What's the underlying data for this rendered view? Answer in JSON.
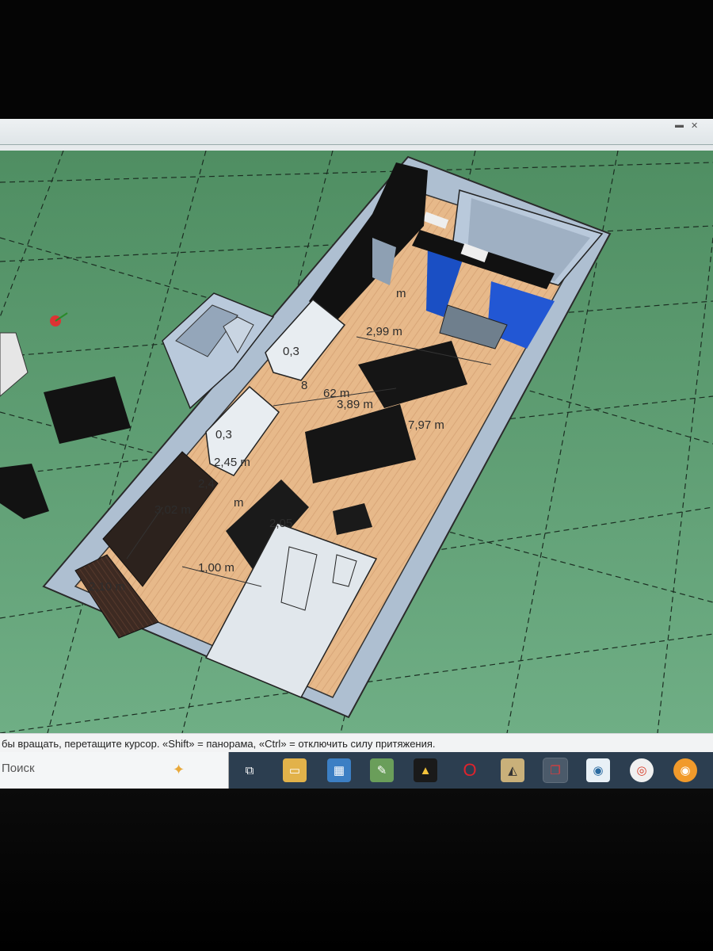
{
  "app": {
    "name": "SketchUp"
  },
  "dimensions": [
    "m",
    "2,99 m",
    "0,3",
    "8",
    "62 m",
    "3,89 m",
    "7,97 m",
    "0,3",
    "2,45 m",
    "2,4",
    "3,02 m",
    "m",
    "2,05",
    "1,00 m",
    "2,10 m"
  ],
  "status_bar": {
    "hint": "бы вращать, перетащите курсор. «Shift» = панорама, «Ctrl» = отключить силу притяжения."
  },
  "taskbar": {
    "search_label": "Поиск",
    "icons": [
      "task-view-icon",
      "file-explorer-icon",
      "calculator-icon",
      "paint-icon",
      "avast-icon",
      "opera-icon",
      "media-player-icon",
      "sketchup-icon",
      "browser-icon",
      "chrome-icon",
      "firefox-icon"
    ]
  },
  "colors": {
    "ground": "#5f9d6e",
    "floor": "#e7b98a",
    "walls": "#b9c9db",
    "furniture": "#151515",
    "glass": "#1a4fc4",
    "taskbar": "#2c3e50"
  }
}
